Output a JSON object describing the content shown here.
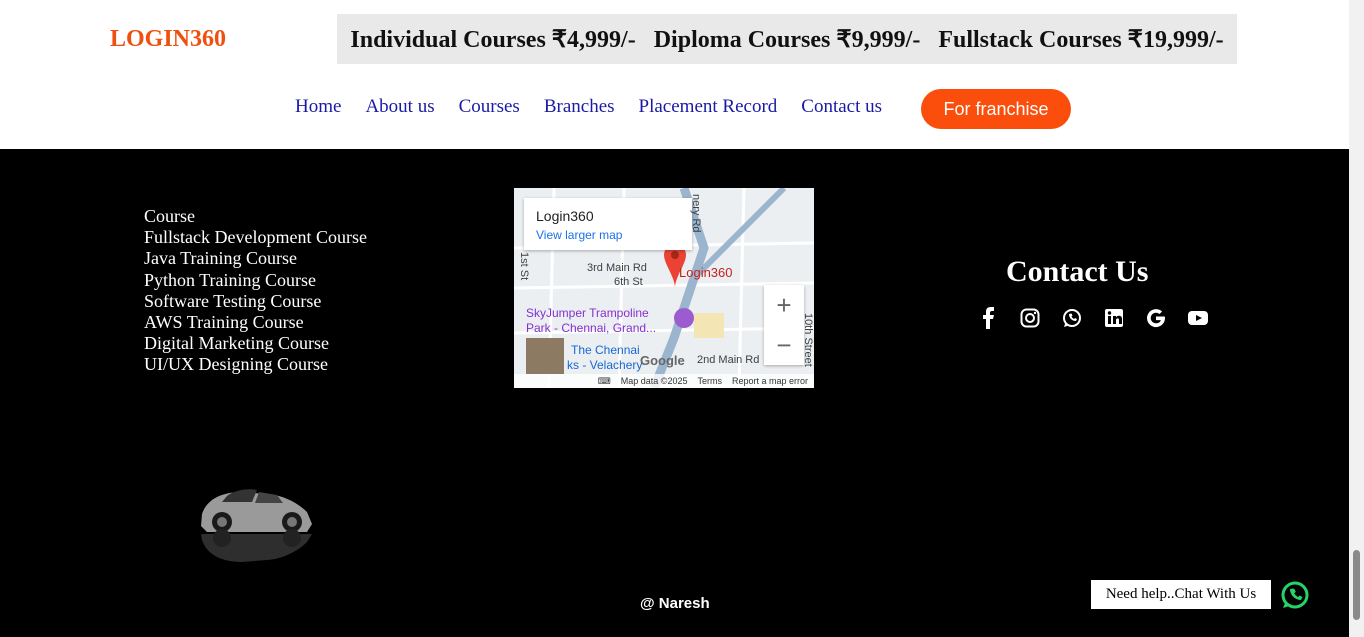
{
  "brand": {
    "logo": "LOGIN360"
  },
  "pricing": [
    "Individual Courses ₹4,999/-",
    "Diploma Courses ₹9,999/-",
    "Fullstack Courses ₹19,999/-"
  ],
  "nav": [
    "Home",
    "About us",
    "Courses",
    "Branches",
    "Placement Record",
    "Contact us"
  ],
  "franchise_button": "For franchise",
  "courses": {
    "heading": "Course",
    "items": [
      "Fullstack Development Course",
      "Java Training Course",
      "Python Training Course",
      "Software Testing Course",
      "AWS Training Course",
      "Digital Marketing Course",
      "UI/UX Designing Course"
    ]
  },
  "map": {
    "place": "Login360",
    "larger_link": "View larger map",
    "pin_label": "Login360",
    "labels": [
      "3rd Main Rd",
      "6th St",
      "SkyJumper Trampoline",
      "Park - Chennai, Grand...",
      "The Chennai",
      "ks - Velachery",
      "2nd Main Rd",
      "nery Rd",
      "1st St",
      "10th Street"
    ],
    "footer": [
      "Map data ©2025",
      "Terms",
      "Report a map error"
    ],
    "google": "Google"
  },
  "contact": {
    "title": "Contact Us",
    "icons": [
      "facebook-icon",
      "instagram-icon",
      "whatsapp-icon",
      "linkedin-icon",
      "google-icon",
      "youtube-icon"
    ]
  },
  "footer": {
    "copyright": "@ Naresh"
  },
  "chat": {
    "label": "Need help..Chat With Us"
  }
}
